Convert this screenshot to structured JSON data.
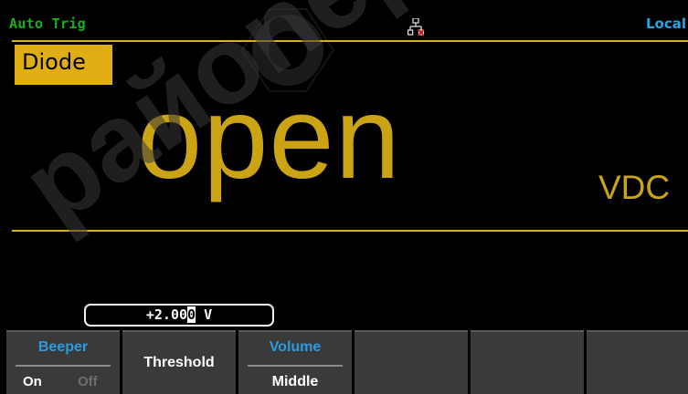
{
  "status": {
    "trigger_mode": "Auto Trig",
    "network_icon": "lan-disconnected-icon",
    "remote_state": "Local"
  },
  "mode": {
    "label": "Diode"
  },
  "measurement": {
    "reading": "open",
    "unit": "VDC"
  },
  "threshold": {
    "value_before_cursor": "+2.00",
    "cursor_digit": "0",
    "value_after_cursor": " V"
  },
  "softkeys": [
    {
      "title": "Beeper",
      "options": [
        "On",
        "Off"
      ],
      "selected": "On"
    },
    {
      "label": "Threshold"
    },
    {
      "title": "Volume",
      "value": "Middle"
    },
    {
      "label": ""
    },
    {
      "label": ""
    },
    {
      "label": ""
    }
  ],
  "colors": {
    "accent": "#cba416",
    "trigger_green": "#19b01e",
    "softkey_blue": "#2b9be0",
    "background": "#000000"
  },
  "watermark": {
    "text": "pайоnepaйo"
  }
}
